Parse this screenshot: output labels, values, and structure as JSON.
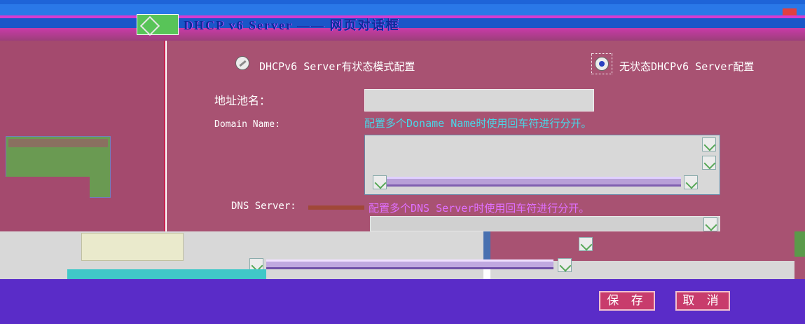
{
  "window": {
    "title": "DHCP v6 Server —— 网页对话框"
  },
  "mode": {
    "stateful_label": "DHCPv6 Server有状态模式配置",
    "stateless_label": "无状态DHCPv6 Server配置",
    "selected": "stateless"
  },
  "form": {
    "pool_name_label": "地址池名：",
    "pool_name_value": "",
    "domain_name_label": "Domain Name:",
    "domain_name_hint": "配置多个Doname Name时使用回车符进行分开。",
    "domain_name_value": "",
    "dns_server_label": "DNS Server:",
    "dns_server_hint": "配置多个DNS Server时使用回车符进行分开。",
    "dns_server_value": ""
  },
  "buttons": {
    "save_label": "保 存",
    "cancel_label": "取 消"
  },
  "icons": [
    "dialog-icon",
    "close-icon",
    "radio-unselected-icon",
    "radio-selected-icon",
    "scroll-arrow-icon"
  ],
  "colors": {
    "panel_background": "#a85272",
    "footer_background": "#5a2cc8",
    "button_background": "#c83c6c",
    "hint_cyan": "#48d8e8",
    "hint_pink": "#e070ff"
  }
}
